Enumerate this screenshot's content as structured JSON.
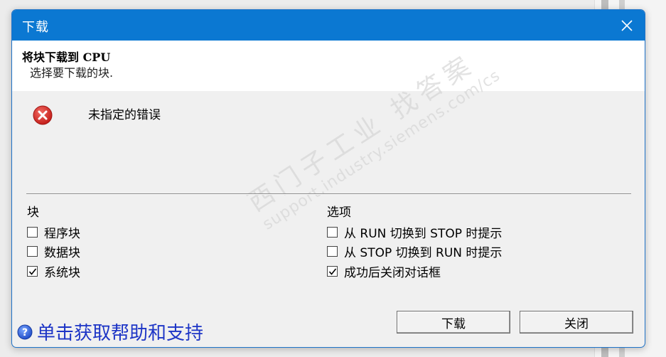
{
  "window": {
    "title": "下载",
    "close_icon": "close-icon"
  },
  "header": {
    "title": "将块下载到 CPU",
    "subtitle": "选择要下载的块."
  },
  "message": {
    "icon": "error-icon",
    "text": "未指定的错误"
  },
  "blocks": {
    "label": "块",
    "items": [
      {
        "label": "程序块",
        "checked": false
      },
      {
        "label": "数据块",
        "checked": false
      },
      {
        "label": "系统块",
        "checked": true
      }
    ]
  },
  "options": {
    "label": "选项",
    "items": [
      {
        "label": "从 RUN 切换到 STOP 时提示",
        "checked": false
      },
      {
        "label": "从 STOP 切换到 RUN 时提示",
        "checked": false
      },
      {
        "label": "成功后关闭对话框",
        "checked": true
      }
    ]
  },
  "buttons": {
    "download": "下载",
    "close": "关闭"
  },
  "help": {
    "icon": "help-icon",
    "text": "单击获取帮助和支持"
  },
  "watermark": {
    "line1": "西门子工业  找答案",
    "line2": "support.industry.siemens.com/cs"
  },
  "colors": {
    "titlebar": "#0b78d2",
    "error": "#d9322c",
    "link": "#1d35c6"
  }
}
